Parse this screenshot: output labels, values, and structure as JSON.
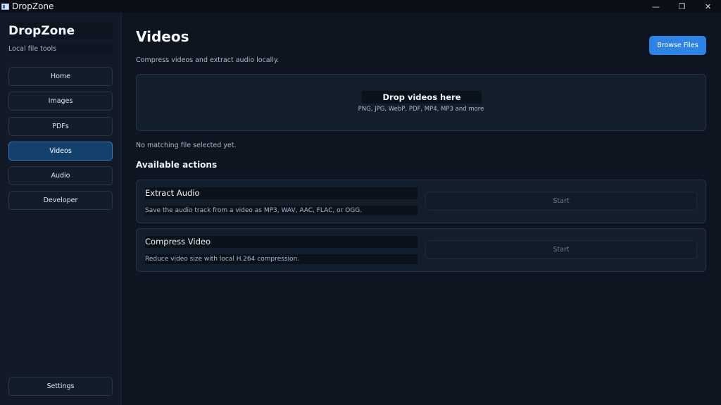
{
  "window": {
    "title": "DropZone",
    "controls": {
      "minimize": "—",
      "restore": "❐",
      "close": "✕"
    }
  },
  "sidebar": {
    "brand": "DropZone",
    "subtitle": "Local file tools",
    "items": [
      {
        "label": "Home"
      },
      {
        "label": "Images"
      },
      {
        "label": "PDFs"
      },
      {
        "label": "Videos"
      },
      {
        "label": "Audio"
      },
      {
        "label": "Developer"
      }
    ],
    "settings_label": "Settings"
  },
  "main": {
    "title": "Videos",
    "description": "Compress videos and extract audio locally.",
    "browse_label": "Browse Files",
    "dropzone": {
      "title": "Drop videos here",
      "formats": "PNG, JPG, WebP, PDF, MP4, MP3 and more"
    },
    "status": "No matching file selected yet.",
    "actions_heading": "Available actions",
    "actions": [
      {
        "name": "Extract Audio",
        "description": "Save the audio track from a video as MP3, WAV, AAC, FLAC, or OGG.",
        "button": "Start"
      },
      {
        "name": "Compress Video",
        "description": "Reduce video size with local H.264 compression.",
        "button": "Start"
      }
    ]
  },
  "colors": {
    "accent": "#2b84e6",
    "active_nav": "#14406e",
    "background": "#0e1520",
    "sidebar": "#111a26"
  }
}
